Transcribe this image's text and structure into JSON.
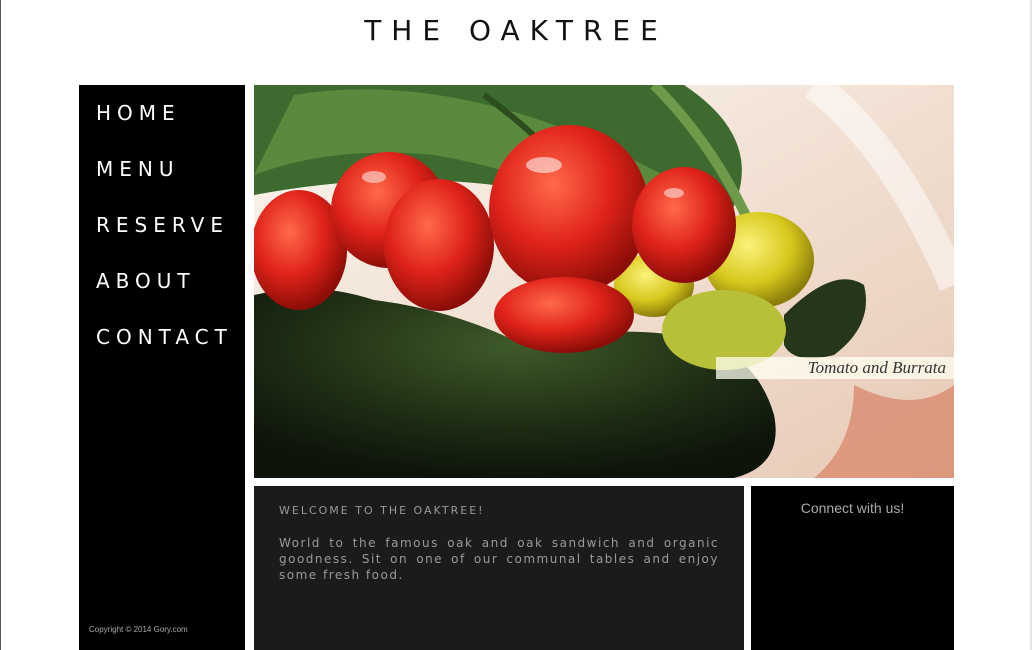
{
  "site": {
    "title": "THE OAKTREE"
  },
  "nav": {
    "items": [
      {
        "label": "HOME"
      },
      {
        "label": "MENU"
      },
      {
        "label": "RESERVE"
      },
      {
        "label": "ABOUT"
      },
      {
        "label": "CONTACT"
      }
    ]
  },
  "sidebar": {
    "copyright": "Copyright © 2014 Gory.com"
  },
  "hero": {
    "caption": "Tomato and Burrata"
  },
  "welcome": {
    "title": "WELCOME TO THE OAKTREE!",
    "body": "World to the famous oak and oak sandwich and organic goodness. Sit on one of our communal tables and enjoy some fresh food."
  },
  "connect": {
    "title": "Connect with us!"
  },
  "colors": {
    "background": "#ffffff",
    "sidebar": "#000000",
    "welcome_panel": "#1b1b1b",
    "nav_text": "#ffffff",
    "muted_text": "#999999"
  }
}
